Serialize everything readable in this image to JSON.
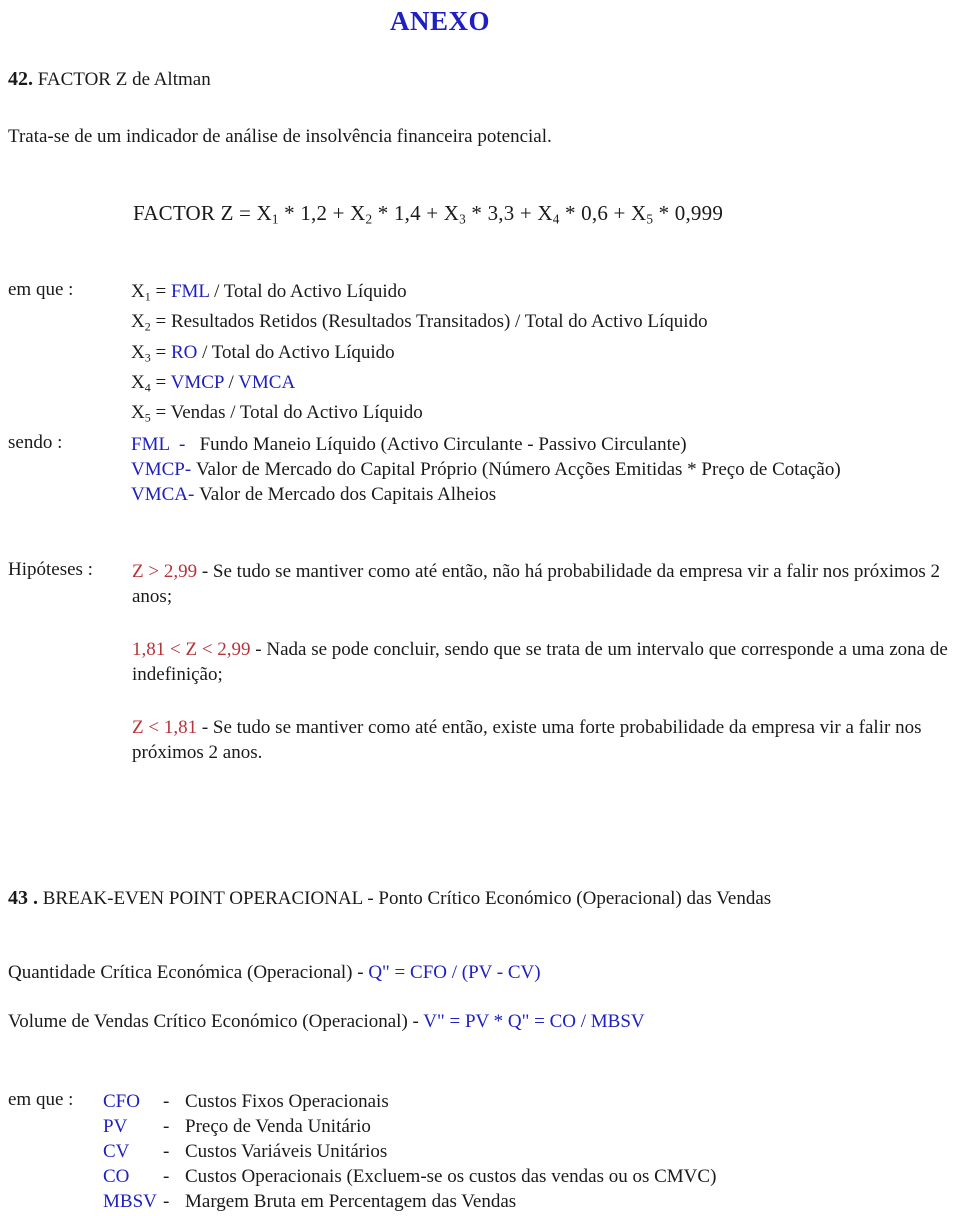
{
  "colors": {
    "blue": "#2020c0",
    "red": "#b6343b",
    "text": "#1a1a1a",
    "background": "#ffffff"
  },
  "document": {
    "title": "ANEXO"
  },
  "section_42": {
    "number": "42.",
    "heading": "FACTOR Z de Altman",
    "intro": "Trata-se de um indicador de análise de insolvência financeira potencial.",
    "formula": {
      "lhs": "FACTOR Z  =  ",
      "terms": [
        {
          "var": "X",
          "sub": "1",
          "op": " * ",
          "coef": "1,2"
        },
        {
          "var": "X",
          "sub": "2",
          "op": " * ",
          "coef": "1,4"
        },
        {
          "var": "X",
          "sub": "3",
          "op": " * ",
          "coef": "3,3"
        },
        {
          "var": "X",
          "sub": "4",
          "op": " * ",
          "coef": "0,6"
        },
        {
          "var": "X",
          "sub": "5",
          "op": " * ",
          "coef": "0,999"
        }
      ],
      "plain": "FACTOR Z  =  X1 * 1,2 + X2 * 1,4 + X3 * 3,3 + X4 * 0,6 + X5 * 0,999"
    },
    "em_que_label": "em que :",
    "variables": [
      {
        "var": "X",
        "sub": "1",
        "eq": " = ",
        "colored": "FML",
        "rest": " / Total do Activo Líquido"
      },
      {
        "var": "X",
        "sub": "2",
        "eq": " = ",
        "colored": "",
        "rest": "Resultados Retidos (Resultados Transitados) / Total do Activo Líquido"
      },
      {
        "var": "X",
        "sub": "3",
        "eq": " = ",
        "colored": "RO",
        "rest": " / Total do Activo Líquido"
      },
      {
        "var": "X",
        "sub": "4",
        "eq": " = ",
        "colored": "VMCP",
        "rest": " / ",
        "colored2": "VMCA"
      },
      {
        "var": "X",
        "sub": "5",
        "eq": " = ",
        "colored": "",
        "rest": "Vendas / Total do Activo Líquido"
      }
    ],
    "sendo_label": "sendo :",
    "definitions": [
      {
        "abbr": "FML",
        "dash": "-",
        "text": "Fundo Maneio Líquido (Activo Circulante - Passivo Circulante)"
      },
      {
        "abbr": "VMCP",
        "dash": "-",
        "text": "Valor de Mercado do Capital Próprio (Número Acções Emitidas * Preço de Cotação)"
      },
      {
        "abbr": "VMCA",
        "dash": "-",
        "text": "Valor de Mercado dos Capitais Alheios"
      }
    ],
    "hipoteses_label": "Hipóteses :",
    "hypotheses": [
      {
        "condition": "Z > 2,99",
        "dash": " -  ",
        "text": "Se tudo se mantiver como até então, não há probabilidade da empresa vir a falir nos próximos 2 anos;"
      },
      {
        "condition": "1,81 < Z < 2,99",
        "dash": " -  ",
        "text": "Nada se pode concluir, sendo que se trata de um intervalo que corresponde a uma zona de indefinição;"
      },
      {
        "condition": "Z < 1,81",
        "dash": " -  ",
        "text": "Se tudo se mantiver como até então, existe uma forte probabilidade da empresa vir a falir nos próximos 2 anos."
      }
    ]
  },
  "section_43": {
    "number": "43 .",
    "heading": "BREAK-EVEN POINT OPERACIONAL  - Ponto Crítico Económico (Operacional) das Vendas",
    "equations": [
      {
        "label": "Quantidade Crítica Económica (Operacional)  -  ",
        "formula": "Q\" = CFO / (PV - CV)"
      },
      {
        "label": "Volume de Vendas Crítico Económico (Operacional)  -  ",
        "formula": "V\" = PV * Q\" = CO / MBSV"
      }
    ],
    "em_que_label": "em que :",
    "legend": [
      {
        "abbr": "CFO",
        "dash": "-",
        "text": "Custos Fixos Operacionais"
      },
      {
        "abbr": "PV",
        "dash": "-",
        "text": "Preço de Venda Unitário"
      },
      {
        "abbr": "CV",
        "dash": "-",
        "text": "Custos Variáveis Unitários"
      },
      {
        "abbr": "CO",
        "dash": "-",
        "text": "Custos Operacionais (Excluem-se os custos das vendas ou os CMVC)"
      },
      {
        "abbr": "MBSV",
        "dash": "-",
        "text": "Margem Bruta em Percentagem das Vendas"
      }
    ]
  }
}
